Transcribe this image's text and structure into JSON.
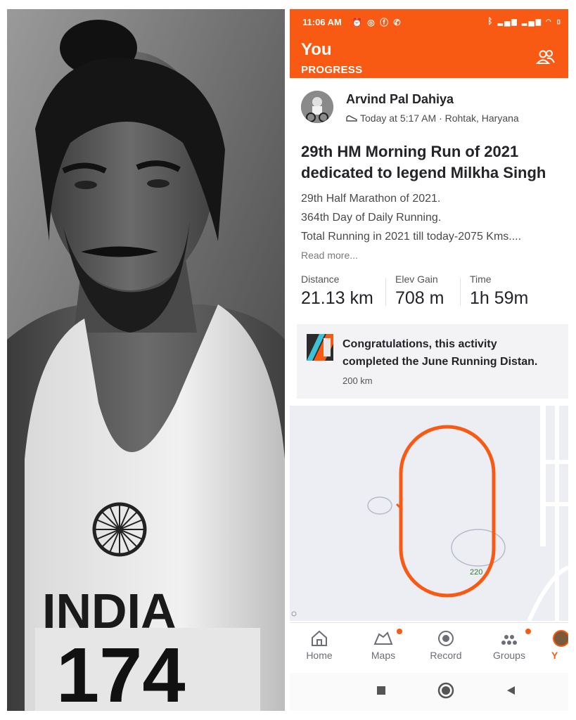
{
  "status_bar": {
    "time": "11:06 AM",
    "left_icons": [
      "alarm-icon",
      "whatsapp-icon",
      "facebook-icon",
      "phone-icon"
    ],
    "right_icons": [
      "bluetooth-icon",
      "signal-icon",
      "signal-icon",
      "wifi-icon",
      "battery-icon"
    ]
  },
  "header": {
    "title": "You",
    "subtitle": "PROGRESS",
    "action_icon": "friends-icon"
  },
  "activity": {
    "athlete": "Arvind Pal Dahiya",
    "meta": "Today at 5:17 AM · Rohtak, Haryana",
    "title_line1": "29th HM Morning Run of 2021",
    "title_line2": "dedicated to legend Milkha Singh",
    "description": [
      "29th Half Marathon of 2021.",
      "364th Day of Daily Running.",
      "Total Running in 2021 till today-2075 Kms...."
    ],
    "read_more": "Read more...",
    "stats": [
      {
        "label": "Distance",
        "value": "21.13 km"
      },
      {
        "label": "Elev Gain",
        "value": "708 m"
      },
      {
        "label": "Time",
        "value": "1h 59m"
      }
    ]
  },
  "achievement": {
    "line1": "Congratulations, this activity",
    "line2": "completed the June Running Distan.",
    "sub": "200 km"
  },
  "map": {
    "route_label": "220",
    "route_color": "#f95a13"
  },
  "tabs": [
    {
      "label": "Home",
      "icon": "home-icon"
    },
    {
      "label": "Maps",
      "icon": "map-icon"
    },
    {
      "label": "Record",
      "icon": "record-icon"
    },
    {
      "label": "Groups",
      "icon": "groups-icon"
    },
    {
      "label": "Y",
      "icon": "profile-avatar-icon"
    }
  ],
  "nav": [
    "square-icon",
    "circle-icon",
    "back-triangle-icon"
  ],
  "photo": {
    "jersey_text": "INDIA",
    "bib_number": "174"
  },
  "colors": {
    "accent": "#f95a13",
    "text": "#242428"
  }
}
